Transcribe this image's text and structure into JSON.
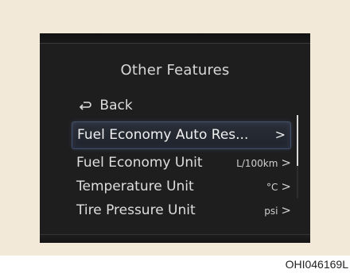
{
  "screen": {
    "title": "Other Features",
    "back_label": "Back",
    "items": [
      {
        "label": "Fuel Economy Auto Res...",
        "value": "",
        "chevron": ">"
      },
      {
        "label": "Fuel Economy Unit",
        "value": "L/100km",
        "chevron": ">"
      },
      {
        "label": "Temperature Unit",
        "value": "°C",
        "chevron": ">"
      },
      {
        "label": "Tire Pressure Unit",
        "value": "psi",
        "chevron": ">"
      }
    ],
    "selected_index": 0
  },
  "figure_id": "OHI046169L",
  "colors": {
    "panel_background": "#f3e9d8",
    "screen_background": "#1e1e1e",
    "text": "#dedede",
    "selection_border": "#43506a"
  },
  "icons": {
    "back": "back-arrow-icon",
    "chevron": "chevron-right-icon"
  }
}
